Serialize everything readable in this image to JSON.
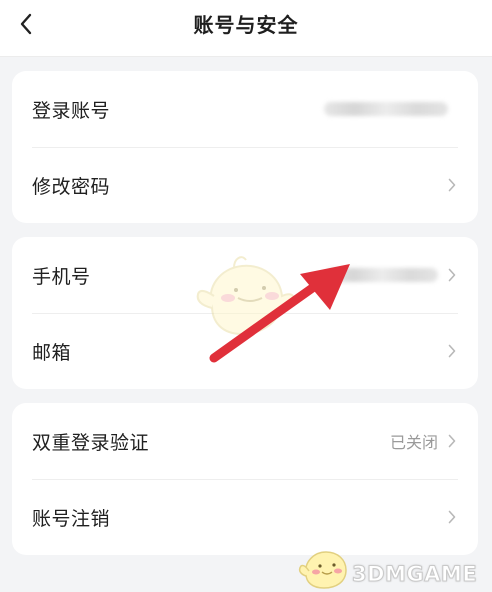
{
  "header": {
    "title": "账号与安全"
  },
  "sections": [
    {
      "rows": [
        {
          "label": "登录账号",
          "value": "",
          "has_chevron": false
        },
        {
          "label": "修改密码",
          "value": "",
          "has_chevron": true
        }
      ]
    },
    {
      "rows": [
        {
          "label": "手机号",
          "value": "",
          "has_chevron": true
        },
        {
          "label": "邮箱",
          "value": "",
          "has_chevron": true
        }
      ]
    },
    {
      "rows": [
        {
          "label": "双重登录验证",
          "value": "已关闭",
          "has_chevron": true
        },
        {
          "label": "账号注销",
          "value": "",
          "has_chevron": true
        }
      ]
    }
  ],
  "icons": {
    "back": "chevron-left-icon",
    "row_arrow": "chevron-right-icon"
  },
  "colors": {
    "background": "#f3f4f6",
    "card": "#ffffff",
    "arrow_annotation": "#e0303a",
    "secondary_text": "#9a9a9a"
  },
  "watermark": {
    "text": "3DMGAME"
  }
}
